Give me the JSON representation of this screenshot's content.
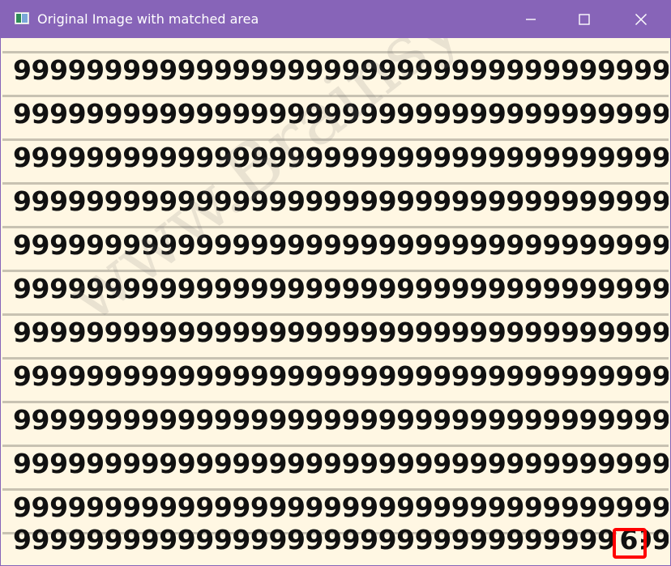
{
  "window": {
    "title": "Original Image with matched area",
    "accent_color": "#8764b8",
    "icons": {
      "app": "image-app-icon",
      "minimize": "minimize-icon",
      "maximize": "maximize-icon",
      "close": "close-icon"
    }
  },
  "puzzle": {
    "background_color": "#fff7e3",
    "rows": [
      "9999999999999999999999999999999999999",
      "9999999999999999999999999999999999999",
      "9999999999999999999999999999999999999",
      "9999999999999999999999999999999999999",
      "9999999999999999999999999999999999999",
      "9999999999999999999999999999999999999",
      "9999999999999999999999999999999999999",
      "9999999999999999999999999999999999999",
      "9999999999999999999999999999999999999",
      "9999999999999999999999999999999999999",
      "9999999999999999999999999999999999999",
      "999999999999999999999999999999999999"
    ],
    "odd_digit": "6",
    "watermark": "www.Brainsyoga.com",
    "match_color": "#ff0000"
  }
}
